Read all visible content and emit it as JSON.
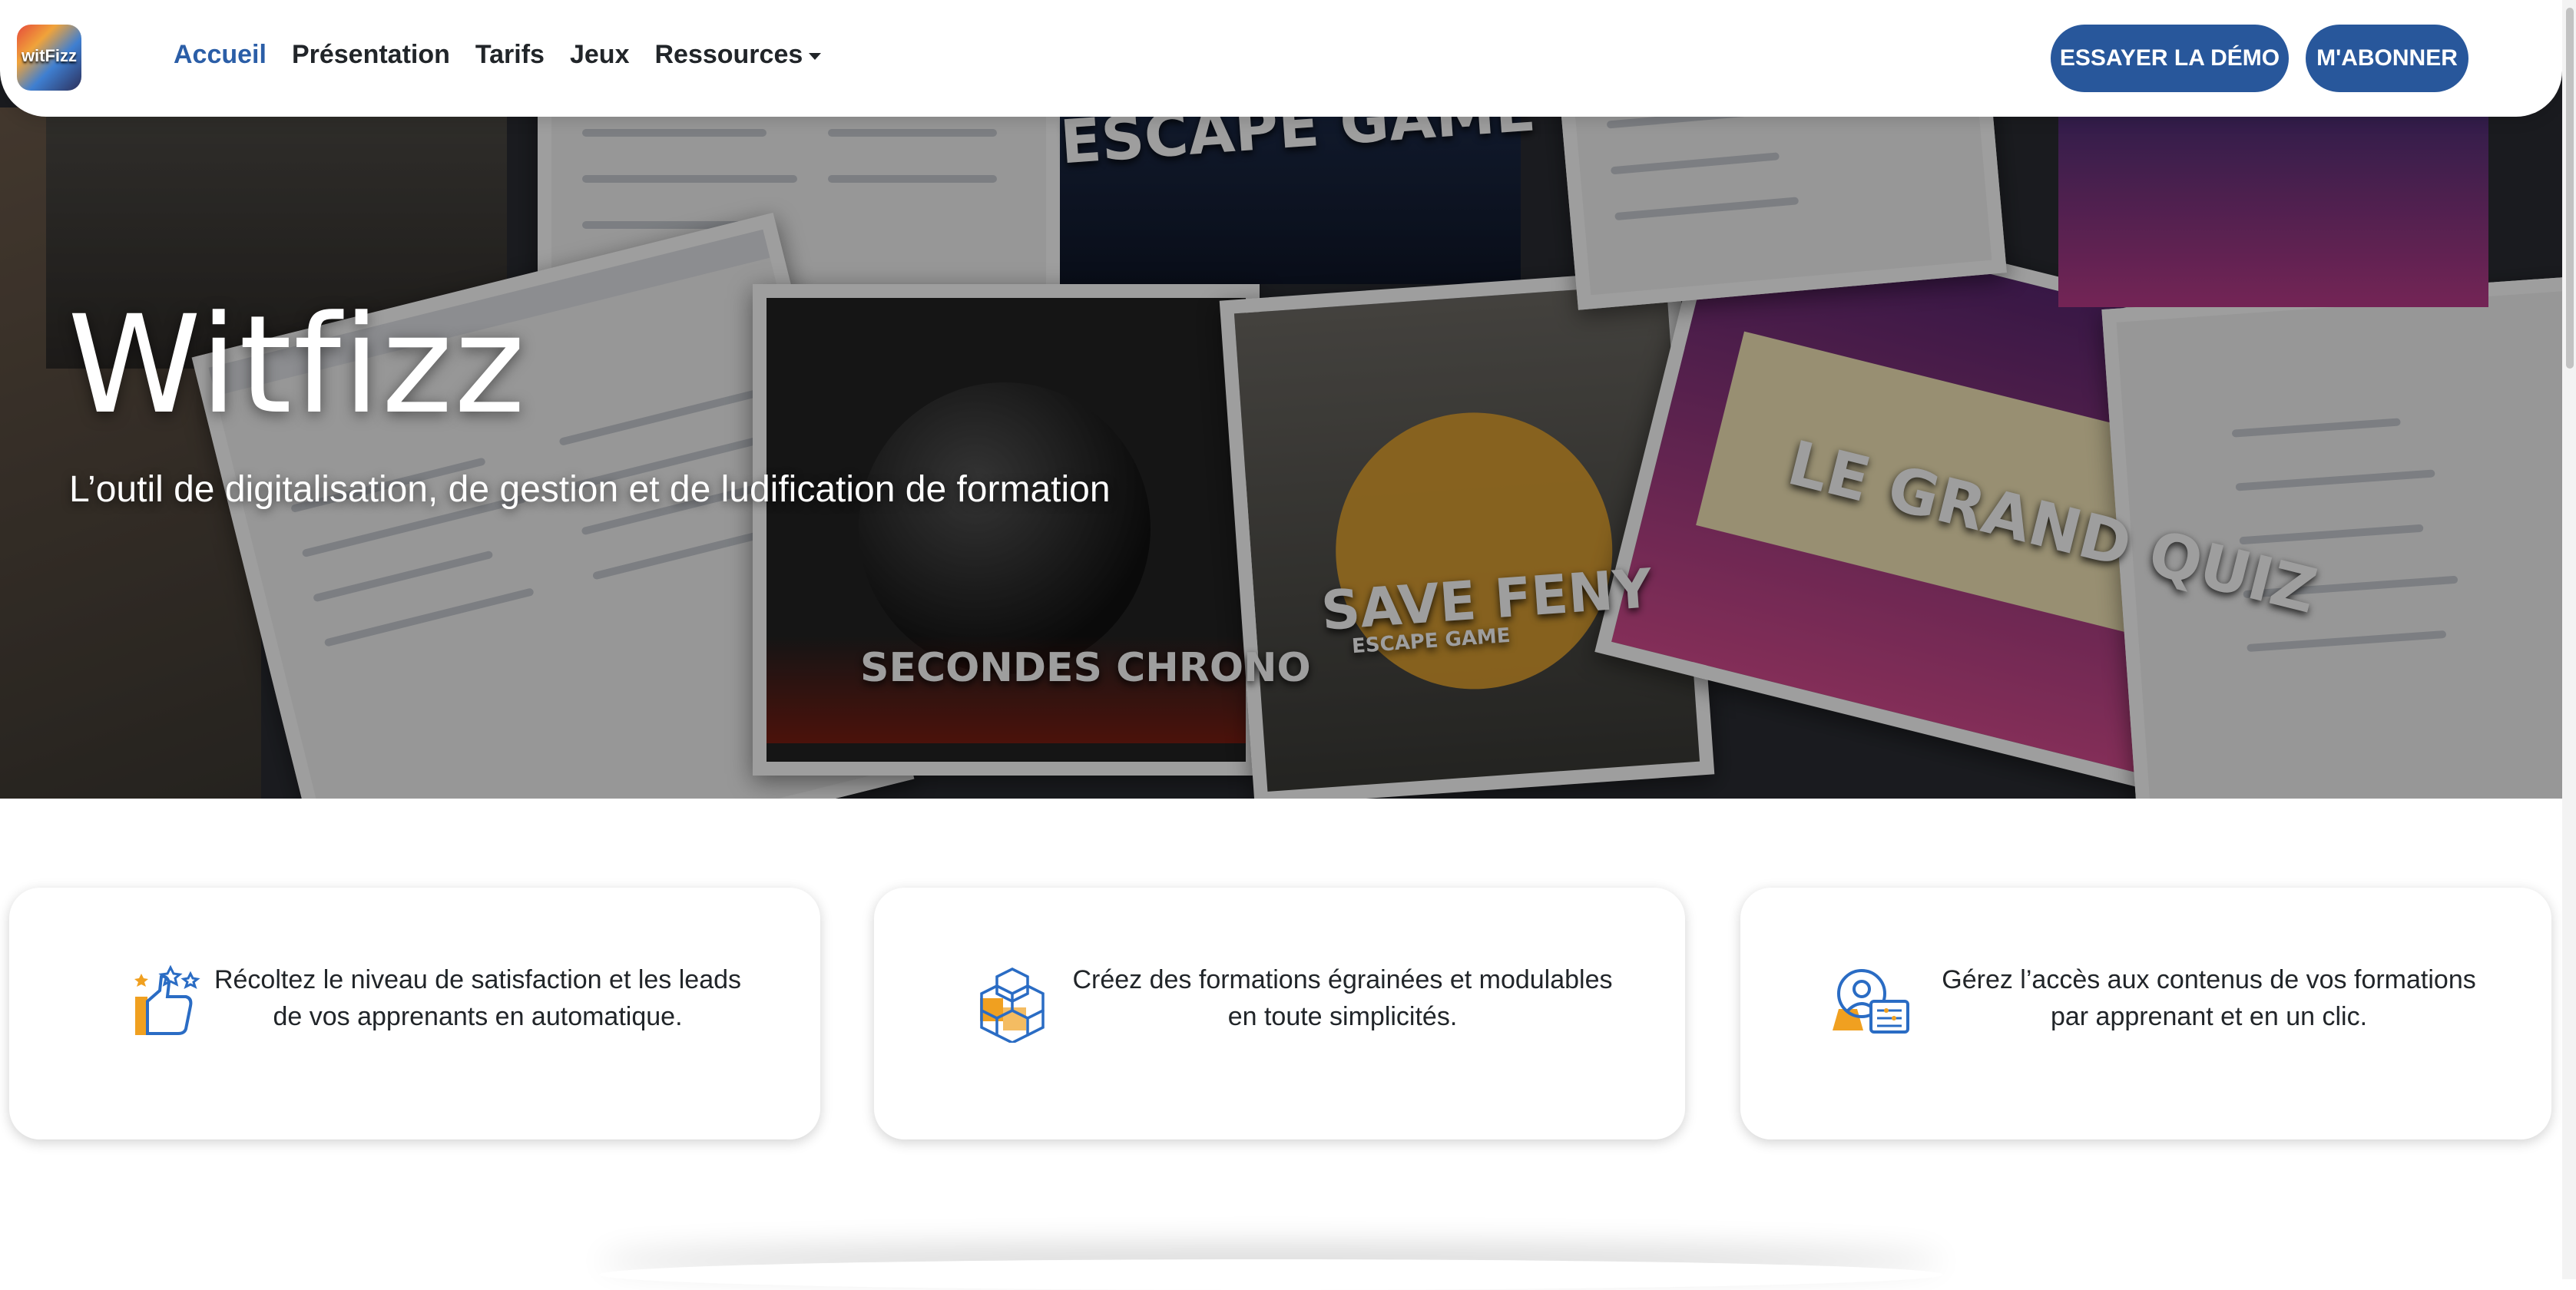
{
  "nav": {
    "logo_text": "witFizz",
    "links": [
      "Accueil",
      "Présentation",
      "Tarifs",
      "Jeux",
      "Ressources"
    ],
    "demo_button": "ESSAYER LA DÉMO",
    "subscribe_button": "M'ABONNER"
  },
  "hero": {
    "title": "Witfizz",
    "subtitle": "L’outil de digitalisation, de gestion et de ludification de formation",
    "collage_captions": [
      "ESCAPE GAME",
      "SECONDES CHRONO",
      "SAVE FENY",
      "ESCAPE GAME",
      "LE GRAND QUIZ"
    ]
  },
  "features": [
    {
      "icon": "thumbs-up-stars-icon",
      "text_lines": [
        "Récoltez le niveau de satisfaction et les leads",
        "de vos apprenants en automatique."
      ]
    },
    {
      "icon": "cubes-icon",
      "text_lines": [
        "Créez des formations égrainées et modulables",
        "en toute simplicités."
      ]
    },
    {
      "icon": "user-access-icon",
      "text_lines": [
        "Gérez l’accès aux contenus de vos formations",
        "par apprenant et en un clic."
      ]
    }
  ],
  "colors": {
    "accent": "#28579b",
    "active_link": "#2b5ea7",
    "icon_orange": "#f0a020",
    "icon_blue": "#2a6cc4"
  }
}
